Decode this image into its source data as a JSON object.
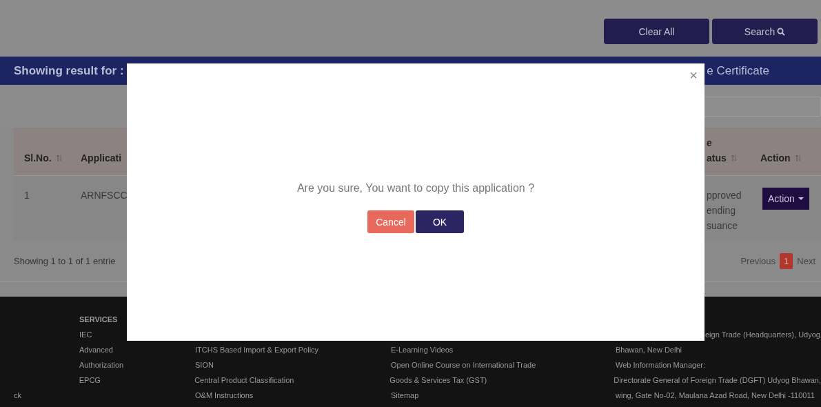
{
  "top_buttons": [
    {
      "label": "Clear All",
      "kind": "plain"
    },
    {
      "label": "Search",
      "kind": "search"
    }
  ],
  "result_bar": {
    "left": "Showing result for :",
    "right": "e Certificate"
  },
  "table": {
    "columns": [
      {
        "label": "Sl.No.",
        "sortable": true
      },
      {
        "label": "Applicati"
      },
      {
        "label": "e atus",
        "sortable": true
      },
      {
        "label": "Action",
        "sortable": true
      }
    ],
    "rows": [
      {
        "cells": [
          "1",
          "ARNFSCC",
          "pproved ending suance"
        ],
        "action": "Action"
      }
    ]
  },
  "table_info": "Showing 1 to 1 of 1 entrie",
  "pagination": [
    {
      "label": "Previous",
      "selected": false
    },
    {
      "label": "1",
      "selected": true
    },
    {
      "label": "Next",
      "selected": false
    }
  ],
  "footer": {
    "rows": [
      {
        "kind": "heading",
        "column_2": "SERVICES"
      },
      {
        "kind": "link",
        "column_2": "IEC",
        "column_5": "eign Trade (Headquarters), Udyog"
      },
      {
        "kind": "link",
        "column_2": "Advanced",
        "column_3": "ITCHS Based Import & Export Policy",
        "column_4": "E-Learning Videos",
        "column_5": "Bhawan, New Delhi"
      },
      {
        "kind": "link",
        "column_2": "Authorization",
        "column_3": "SION",
        "column_4": "Open Online Course on International Trade",
        "column_5": "Web Information Manager:"
      },
      {
        "kind": "link",
        "column_2": "EPCG",
        "column_3": "Central Product Classification",
        "column_4": "Goods & Services Tax (GST)",
        "column_5": "Directorate General of Foreign Trade (DGFT) Udyog Bhawan,"
      },
      {
        "kind": "link",
        "column_1": "ck",
        "column_3": "O&M Instructions",
        "column_4": "Sitemap",
        "column_5": "wing, Gate No-02, Maulana Azad Road, New Delhi -110011"
      }
    ]
  },
  "dialog": {
    "close": "×",
    "message": "Are you sure, You want to copy this application ?",
    "buttons": [
      {
        "label": "Cancel",
        "kind": "cancel"
      },
      {
        "label": "OK",
        "kind": "ok"
      }
    ]
  }
}
